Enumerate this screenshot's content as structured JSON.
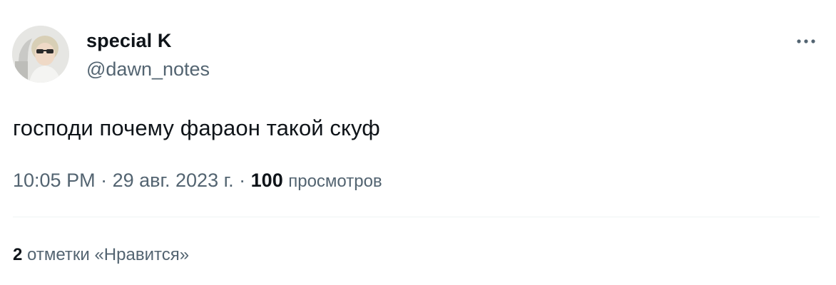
{
  "author": {
    "display_name": "special K",
    "handle": "@dawn_notes",
    "avatar_icon": "profile-photo"
  },
  "tweet": {
    "text": "господи почему фараон такой скуф"
  },
  "meta": {
    "time": "10:05 PM",
    "separator": " · ",
    "date": "29 авг. 2023 г.",
    "views_count": "100",
    "views_label": "просмотров"
  },
  "engagement": {
    "likes_count": "2",
    "likes_label": "отметки «Нравится»"
  },
  "actions": {
    "more_icon": "more-horizontal-icon"
  },
  "colors": {
    "text_primary": "#0f1419",
    "text_secondary": "#536471",
    "divider": "#eff3f4"
  }
}
